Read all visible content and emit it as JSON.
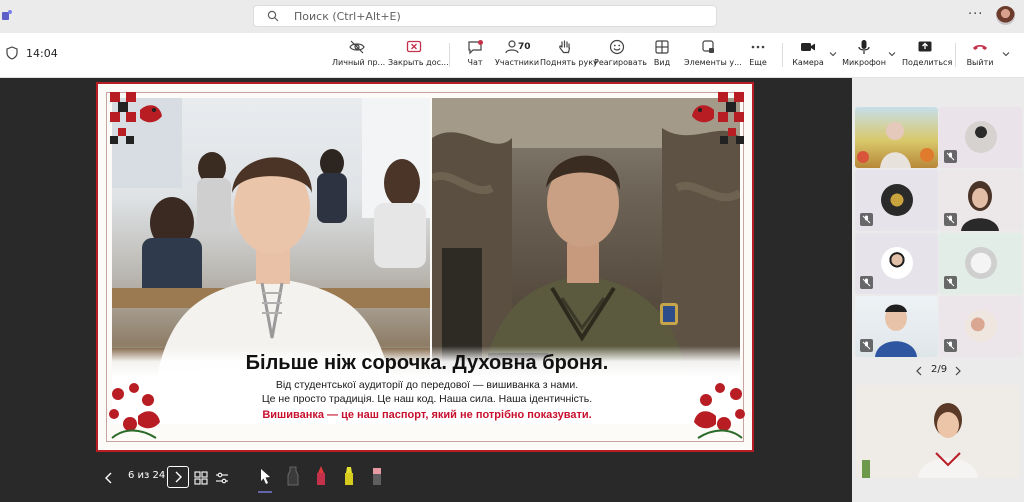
{
  "titlebar": {
    "search_placeholder": "Поиск (Ctrl+Alt+E)",
    "more_label": "···"
  },
  "toolbar": {
    "time": "14:04",
    "items": [
      {
        "label": "Личный пр...",
        "icon": "eye-off-icon"
      },
      {
        "label": "Закрыть дос...",
        "icon": "stop-share-icon"
      },
      {
        "label": "Чат",
        "icon": "chat-icon"
      },
      {
        "label": "Участники",
        "icon": "people-icon",
        "count": "70"
      },
      {
        "label": "Поднять руку",
        "icon": "hand-icon"
      },
      {
        "label": "Реагировать",
        "icon": "smile-icon"
      },
      {
        "label": "Вид",
        "icon": "grid-icon"
      },
      {
        "label": "Элементы у...",
        "icon": "apps-icon"
      },
      {
        "label": "Еще",
        "icon": "more-icon"
      },
      {
        "label": "Камера",
        "icon": "camera-icon"
      },
      {
        "label": "Микрофон",
        "icon": "mic-icon"
      },
      {
        "label": "Поделиться",
        "icon": "share-icon"
      },
      {
        "label": "Выйти",
        "icon": "hangup-icon"
      }
    ]
  },
  "slide": {
    "headline": "Більше ніж сорочка. Духовна броня.",
    "line1": "Від студентської аудиторії до передової — вишиванка з нами.",
    "line2": "Це не просто традиція. Це наш код. Наша сила. Наша ідентичність.",
    "line3": "Вишиванка — це наш паспорт, який не потрібно показувати."
  },
  "slide_nav": {
    "counter": "6 из 24"
  },
  "participants": {
    "pager": "2/9"
  },
  "colors": {
    "accent_red": "#c4314b",
    "slide_red": "#c8102e",
    "stage_bg": "#292929"
  }
}
